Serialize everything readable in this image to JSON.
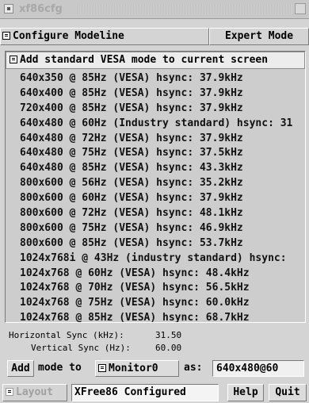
{
  "window": {
    "title": "xf86cfg"
  },
  "header": {
    "menu_label": "Configure Modeline",
    "expert_label": "Expert Mode"
  },
  "list": {
    "header_label": "Add standard VESA mode to current screen",
    "modes": [
      "640x350 @ 85Hz (VESA) hsync: 37.9kHz",
      "640x400 @ 85Hz (VESA) hsync: 37.9kHz",
      "720x400 @ 85Hz (VESA) hsync: 37.9kHz",
      "640x480 @ 60Hz (Industry standard) hsync: 31",
      "640x480 @ 72Hz (VESA) hsync: 37.9kHz",
      "640x480 @ 75Hz (VESA) hsync: 37.5kHz",
      "640x480 @ 85Hz (VESA) hsync: 43.3kHz",
      "800x600 @ 56Hz (VESA) hsync: 35.2kHz",
      "800x600 @ 60Hz (VESA) hsync: 37.9kHz",
      "800x600 @ 72Hz (VESA) hsync: 48.1kHz",
      "800x600 @ 75Hz (VESA) hsync: 46.9kHz",
      "800x600 @ 85Hz (VESA) hsync: 53.7kHz",
      "1024x768i @ 43Hz (industry standard) hsync:",
      "1024x768 @ 60Hz (VESA) hsync: 48.4kHz",
      "1024x768 @ 70Hz (VESA) hsync: 56.5kHz",
      "1024x768 @ 75Hz (VESA) hsync: 60.0kHz",
      "1024x768 @ 85Hz (VESA) hsync: 68.7kHz"
    ]
  },
  "info": {
    "hsync_label": "Horizontal Sync (kHz):",
    "hsync_value": "31.50",
    "vsync_label": "Vertical Sync (Hz):",
    "vsync_value": "60.00"
  },
  "add_row": {
    "add_label": "Add",
    "mode_to_label": "mode to",
    "monitor_label": "Monitor0",
    "as_label": "as:",
    "as_value": "640x480@60"
  },
  "bottom": {
    "layout_label": "Layout",
    "status_text": "XFree86 Configured",
    "help_label": "Help",
    "quit_label": "Quit"
  }
}
